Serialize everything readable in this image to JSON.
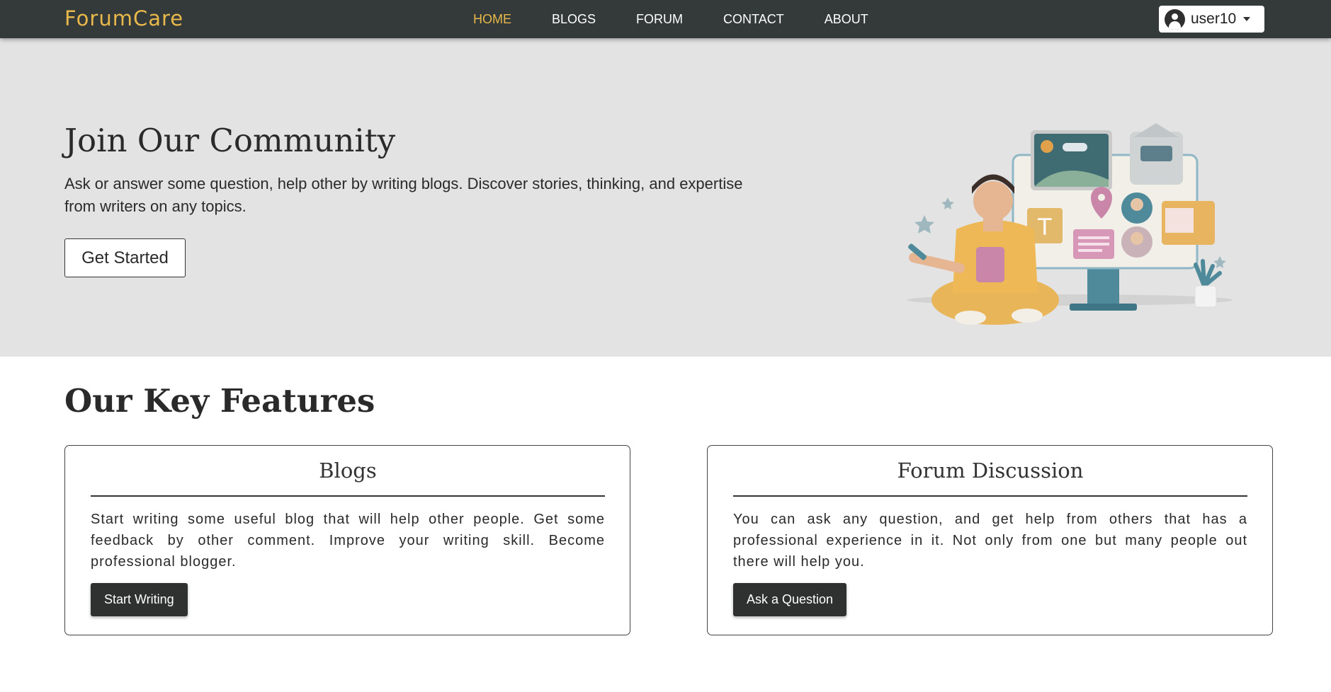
{
  "brand": "ForumCare",
  "nav": {
    "items": [
      {
        "label": "HOME",
        "active": true
      },
      {
        "label": "BLOGS",
        "active": false
      },
      {
        "label": "FORUM",
        "active": false
      },
      {
        "label": "CONTACT",
        "active": false
      },
      {
        "label": "ABOUT",
        "active": false
      }
    ]
  },
  "user": {
    "name": "user10",
    "icon": "user-circle-icon"
  },
  "hero": {
    "title": "Join Our Community",
    "text": "Ask or answer some question, help other by writing blogs. Discover stories, thinking, and expertise from writers on any topics.",
    "cta": "Get Started"
  },
  "features": {
    "title": "Our Key Features",
    "cards": [
      {
        "title": "Blogs",
        "text": "Start writing some useful blog that will help other people. Get some feedback by other comment. Improve your writing skill. Become professional blogger.",
        "button": "Start Writing"
      },
      {
        "title": "Forum Discussion",
        "text": "You can ask any question, and get help from others that has a professional experience in it. Not only from one but many people out there will help you.",
        "button": "Ask a Question"
      }
    ]
  },
  "colors": {
    "navbar": "#343a3a",
    "accent": "#e8b84a",
    "hero_bg": "#e3e3e3",
    "button_dark": "#2f3030"
  }
}
